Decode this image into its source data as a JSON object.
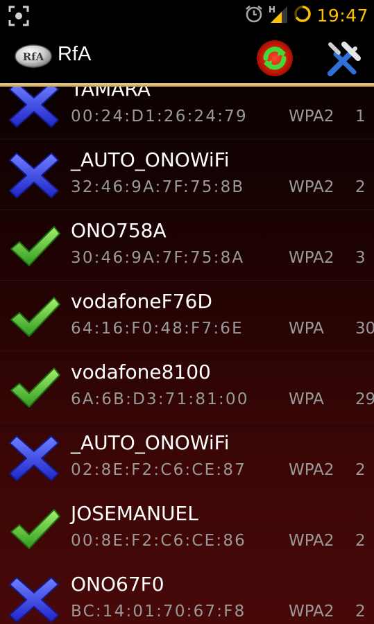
{
  "status_bar": {
    "icons": [
      "screenshot-icon",
      "alarm-icon",
      "signal-icon",
      "battery-icon"
    ],
    "time": "19:47",
    "network_type": "H",
    "time_color": "#ffc000"
  },
  "action_bar": {
    "logo_text": "RfA",
    "title": "RfA",
    "actions": [
      "refresh-icon",
      "tools-icon"
    ],
    "accent_color": "#c49a44"
  },
  "networks": [
    {
      "ssid": "TAMARA",
      "mac": "00:24:D1:26:24:79",
      "security": "WPA2",
      "signal": "1",
      "status": "x-icon"
    },
    {
      "ssid": "_AUTO_ONOWiFi",
      "mac": "32:46:9A:7F:75:8B",
      "security": "WPA2",
      "signal": "2",
      "status": "x-icon"
    },
    {
      "ssid": "ONO758A",
      "mac": "30:46:9A:7F:75:8A",
      "security": "WPA2",
      "signal": "3",
      "status": "check-icon"
    },
    {
      "ssid": "vodafoneF76D",
      "mac": "64:16:F0:48:F7:6E",
      "security": "WPA",
      "signal": "30",
      "status": "check-icon"
    },
    {
      "ssid": "vodafone8100",
      "mac": "6A:6B:D3:71:81:00",
      "security": "WPA",
      "signal": "29",
      "status": "check-icon"
    },
    {
      "ssid": "_AUTO_ONOWiFi",
      "mac": "02:8E:F2:C6:CE:87",
      "security": "WPA2",
      "signal": "2",
      "status": "x-icon"
    },
    {
      "ssid": "JOSEMANUEL",
      "mac": "00:8E:F2:C6:CE:86",
      "security": "WPA2",
      "signal": "2",
      "status": "check-icon"
    },
    {
      "ssid": "ONO67F0",
      "mac": "BC:14:01:70:67:F8",
      "security": "WPA2",
      "signal": "2",
      "status": "x-icon"
    }
  ],
  "colors": {
    "check_green": "#52c83a",
    "x_blue": "#2f3ff0"
  }
}
